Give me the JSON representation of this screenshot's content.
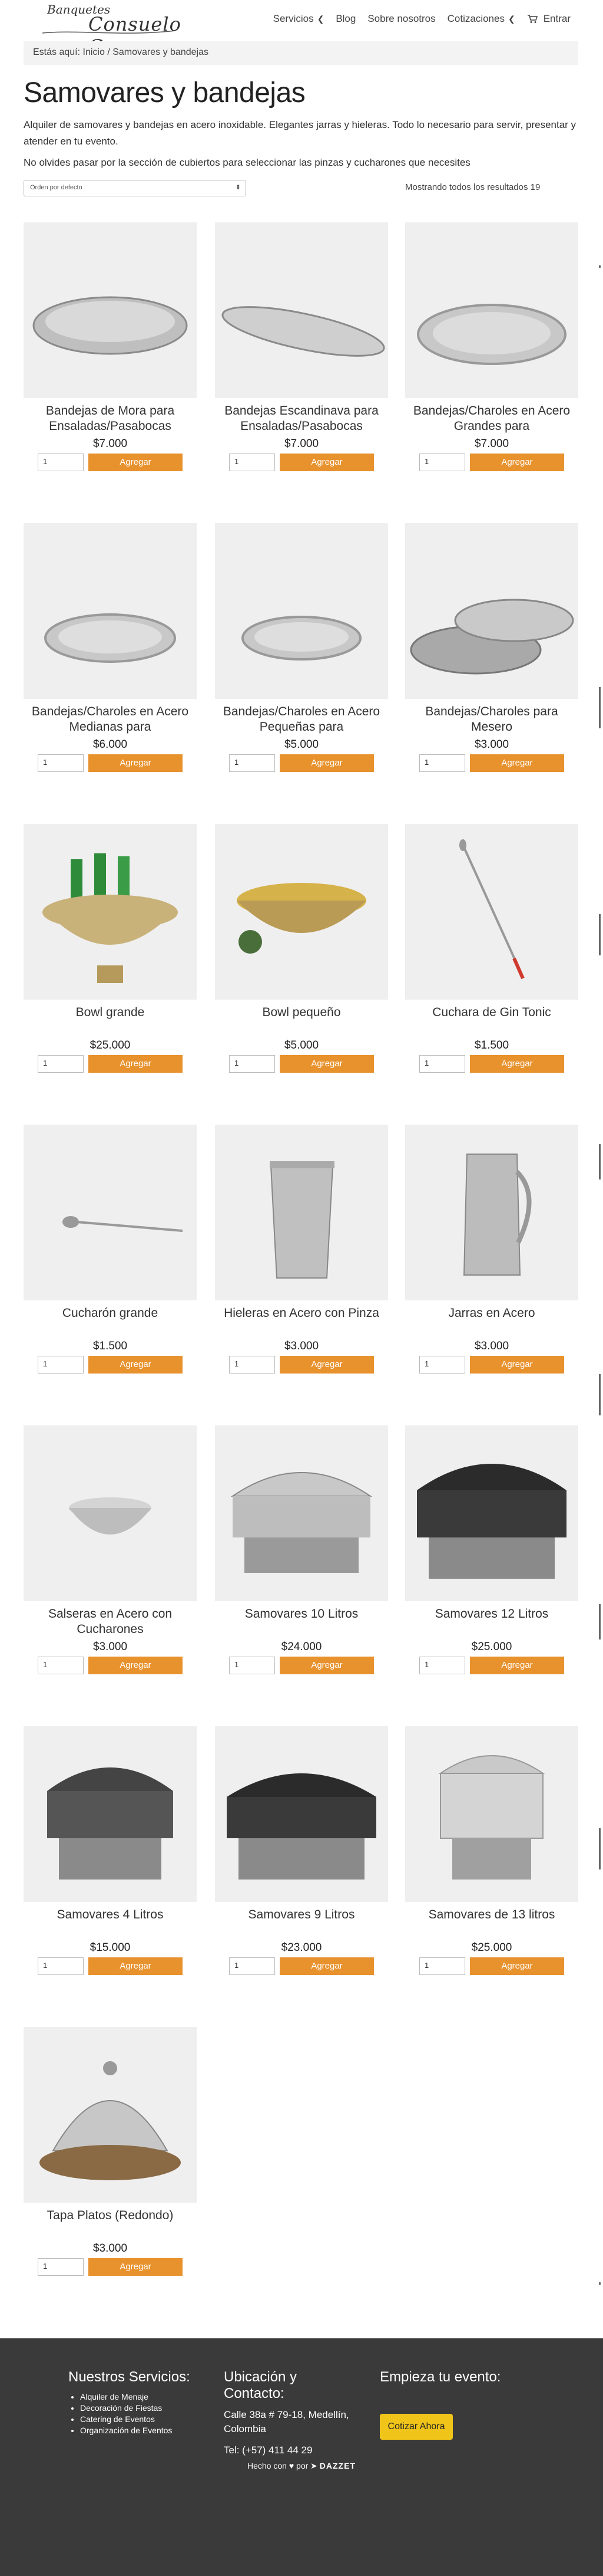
{
  "header": {
    "logo_line1": "Banquetes",
    "logo_line2": "Consuelo C",
    "nav": [
      {
        "label": "Servicios",
        "has_chevron": true
      },
      {
        "label": "Blog",
        "has_chevron": false
      },
      {
        "label": "Sobre nosotros",
        "has_chevron": false
      },
      {
        "label": "Cotizaciones",
        "has_chevron": true
      },
      {
        "label": "Entrar",
        "has_chevron": false,
        "icon": "cart-icon"
      }
    ]
  },
  "breadcrumb": {
    "prefix": "Estás aquí:",
    "home": "Inicio",
    "separator": "/",
    "current": "Samovares y bandejas"
  },
  "page": {
    "title": "Samovares y bandejas",
    "intro": "Alquiler de samovares y bandejas en acero inoxidable. Elegantes jarras y hieleras. Todo lo necesario para servir, presentar y atender en tu evento.",
    "note": "No olvides pasar por la sección de cubiertos para seleccionar las pinzas y cucharones que necesites",
    "sort_label": "Orden por defecto",
    "results_text": "Mostrando todos los resultados 19"
  },
  "accent_color": "#e8922e",
  "products": [
    {
      "name": "Bandejas de Mora para Ensaladas/Pasabocas",
      "price": "$7.000",
      "qty": "1",
      "button": "Agregar",
      "image": "oval-serving-tray"
    },
    {
      "name": "Bandejas Escandinava para Ensaladas/Pasabocas",
      "price": "$7.000",
      "qty": "1",
      "button": "Agregar",
      "image": "long-oval-tray"
    },
    {
      "name": "Bandejas/Charoles en Acero Grandes para",
      "price": "$7.000",
      "qty": "1",
      "button": "Agregar",
      "image": "large-round-tray"
    },
    {
      "name": "Bandejas/Charoles en Acero Medianas para",
      "price": "$6.000",
      "qty": "1",
      "button": "Agregar",
      "image": "medium-round-tray"
    },
    {
      "name": "Bandejas/Charoles en Acero Pequeñas para",
      "price": "$5.000",
      "qty": "1",
      "button": "Agregar",
      "image": "small-round-tray"
    },
    {
      "name": "Bandejas/Charoles para Mesero",
      "price": "$3.000",
      "qty": "1",
      "button": "Agregar",
      "image": "waiter-trays"
    },
    {
      "name": "Bowl grande",
      "price": "$25.000",
      "qty": "1",
      "button": "Agregar",
      "image": "large-bowl-bottles"
    },
    {
      "name": "Bowl pequeño",
      "price": "$5.000",
      "qty": "1",
      "button": "Agregar",
      "image": "small-bowl"
    },
    {
      "name": "Cuchara de Gin Tonic",
      "price": "$1.500",
      "qty": "1",
      "button": "Agregar",
      "image": "gin-tonic-spoon"
    },
    {
      "name": "Cucharón grande",
      "price": "$1.500",
      "qty": "1",
      "button": "Agregar",
      "image": "ladle"
    },
    {
      "name": "Hieleras en Acero con Pinza",
      "price": "$3.000",
      "qty": "1",
      "button": "Agregar",
      "image": "ice-bucket"
    },
    {
      "name": "Jarras en Acero",
      "price": "$3.000",
      "qty": "1",
      "button": "Agregar",
      "image": "steel-pitcher"
    },
    {
      "name": "Salseras en Acero con Cucharones",
      "price": "$3.000",
      "qty": "1",
      "button": "Agregar",
      "image": "sauce-bowl"
    },
    {
      "name": "Samovares 10 Litros",
      "price": "$24.000",
      "qty": "1",
      "button": "Agregar",
      "image": "chafing-10l"
    },
    {
      "name": "Samovares 12 Litros",
      "price": "$25.000",
      "qty": "1",
      "button": "Agregar",
      "image": "chafing-12l"
    },
    {
      "name": "Samovares 4 Litros",
      "price": "$15.000",
      "qty": "1",
      "button": "Agregar",
      "image": "chafing-4l"
    },
    {
      "name": "Samovares 9 Litros",
      "price": "$23.000",
      "qty": "1",
      "button": "Agregar",
      "image": "chafing-9l"
    },
    {
      "name": "Samovares de 13 litros",
      "price": "$25.000",
      "qty": "1",
      "button": "Agregar",
      "image": "chafing-13l"
    },
    {
      "name": "Tapa Platos (Redondo)",
      "price": "$3.000",
      "qty": "1",
      "button": "Agregar",
      "image": "plate-cover"
    }
  ],
  "footer": {
    "services_title": "Nuestros Servicios:",
    "services": [
      "Alquiler de Menaje",
      "Decoración de Fiestas",
      "Catering de Eventos",
      "Organización de Eventos"
    ],
    "location_title": "Ubicación y Contacto:",
    "address": "Calle 38a # 79-18, Medellín, Colombia",
    "phone": "Tel: (+57) 411 44 29",
    "cta_title": "Empieza tu evento:",
    "cta_button": "Cotizar Ahora",
    "credit_prefix": "Hecho con",
    "credit_by": "por",
    "credit_brand": "DAZZET"
  }
}
